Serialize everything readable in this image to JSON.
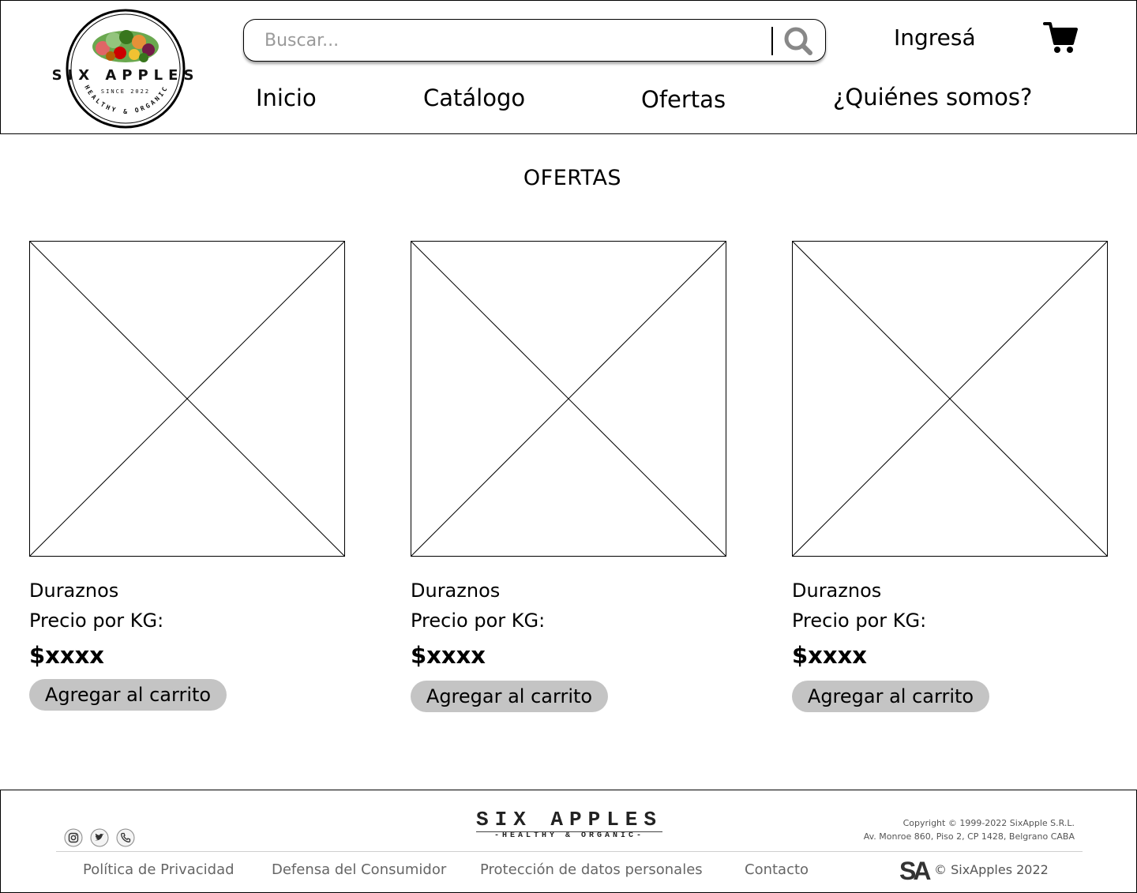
{
  "header": {
    "logo": {
      "brand": "SIX APPLES",
      "since": "SINCE 2022",
      "tagline": "HEALTHY & ORGANIC"
    },
    "search": {
      "placeholder": "Buscar..."
    },
    "login_label": "Ingresá",
    "cart_icon": "shopping-cart-icon",
    "nav": [
      {
        "label": "Inicio"
      },
      {
        "label": "Catálogo"
      },
      {
        "label": "Ofertas"
      },
      {
        "label": "¿Quiénes somos?"
      }
    ]
  },
  "main": {
    "title": "OFERTAS",
    "products": [
      {
        "name": "Duraznos",
        "unit_label": "Precio por KG:",
        "price": "$xxxx",
        "button_label": "Agregar al carrito"
      },
      {
        "name": "Duraznos",
        "unit_label": "Precio por KG:",
        "price": "$xxxx",
        "button_label": "Agregar al carrito"
      },
      {
        "name": "Duraznos",
        "unit_label": "Precio por KG:",
        "price": "$xxxx",
        "button_label": "Agregar al carrito"
      }
    ]
  },
  "footer": {
    "social_icons": [
      "instagram-icon",
      "twitter-icon",
      "phone-icon"
    ],
    "brand": "SIX APPLES",
    "brand_tagline": "-HEALTHY & ORGANIC-",
    "copyright_line1": "Copyright © 1999-2022 SixApple S.R.L.",
    "copyright_line2": "Av. Monroe 860, Piso 2, CP 1428, Belgrano CABA",
    "links": [
      {
        "label": "Política de Privacidad"
      },
      {
        "label": "Defensa del Consumidor"
      },
      {
        "label": "Protección de datos personales"
      },
      {
        "label": "Contacto"
      }
    ],
    "sa_mark": "SA",
    "sa_copy": "© SixApples 2022"
  },
  "colors": {
    "button_bg": "#c4c4c4",
    "border": "#000000",
    "footer_link": "#666666"
  }
}
